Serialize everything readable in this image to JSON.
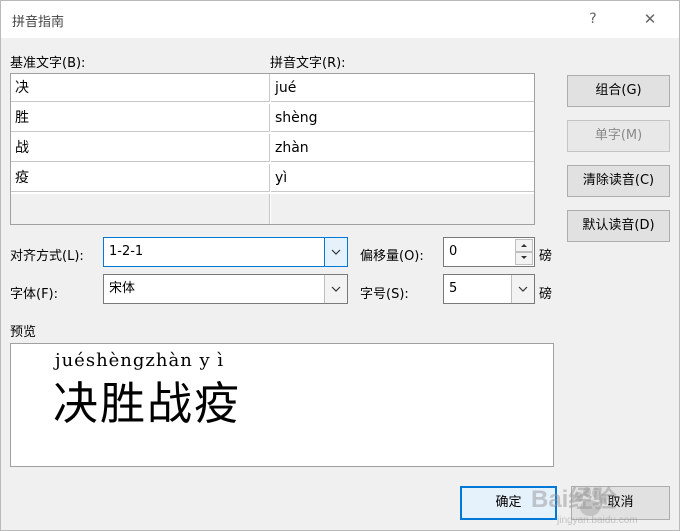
{
  "window": {
    "title": "拼音指南",
    "help_label": "?",
    "close_label": "✕"
  },
  "labels": {
    "base_text": "基准文字(B):",
    "pinyin_text": "拼音文字(R):",
    "alignment": "对齐方式(L):",
    "offset": "偏移量(O):",
    "font": "字体(F):",
    "size": "字号(S):",
    "offset_unit": "磅",
    "size_unit": "磅",
    "preview": "预览"
  },
  "rows": [
    {
      "base": "决",
      "pinyin": "jué"
    },
    {
      "base": "胜",
      "pinyin": "shèng"
    },
    {
      "base": "战",
      "pinyin": "zhàn"
    },
    {
      "base": "疫",
      "pinyin": "yì"
    },
    {
      "base": "",
      "pinyin": ""
    }
  ],
  "buttons": {
    "group": "组合(G)",
    "single": "单字(M)",
    "clear": "清除读音(C)",
    "default": "默认读音(D)",
    "ok": "确定",
    "cancel": "取消"
  },
  "fields": {
    "alignment": "1-2-1",
    "offset": "0",
    "font": "宋体",
    "size": "5"
  },
  "preview": {
    "pinyin": "juéshèngzhàn y ì",
    "base": "决胜战疫"
  },
  "watermark": {
    "text": "Bai经验",
    "domain": "jingyan.baidu.com"
  },
  "colors": {
    "accent": "#0078d7",
    "dialog_bg": "#f0f0f0",
    "button_bg": "#e1e1e1"
  }
}
